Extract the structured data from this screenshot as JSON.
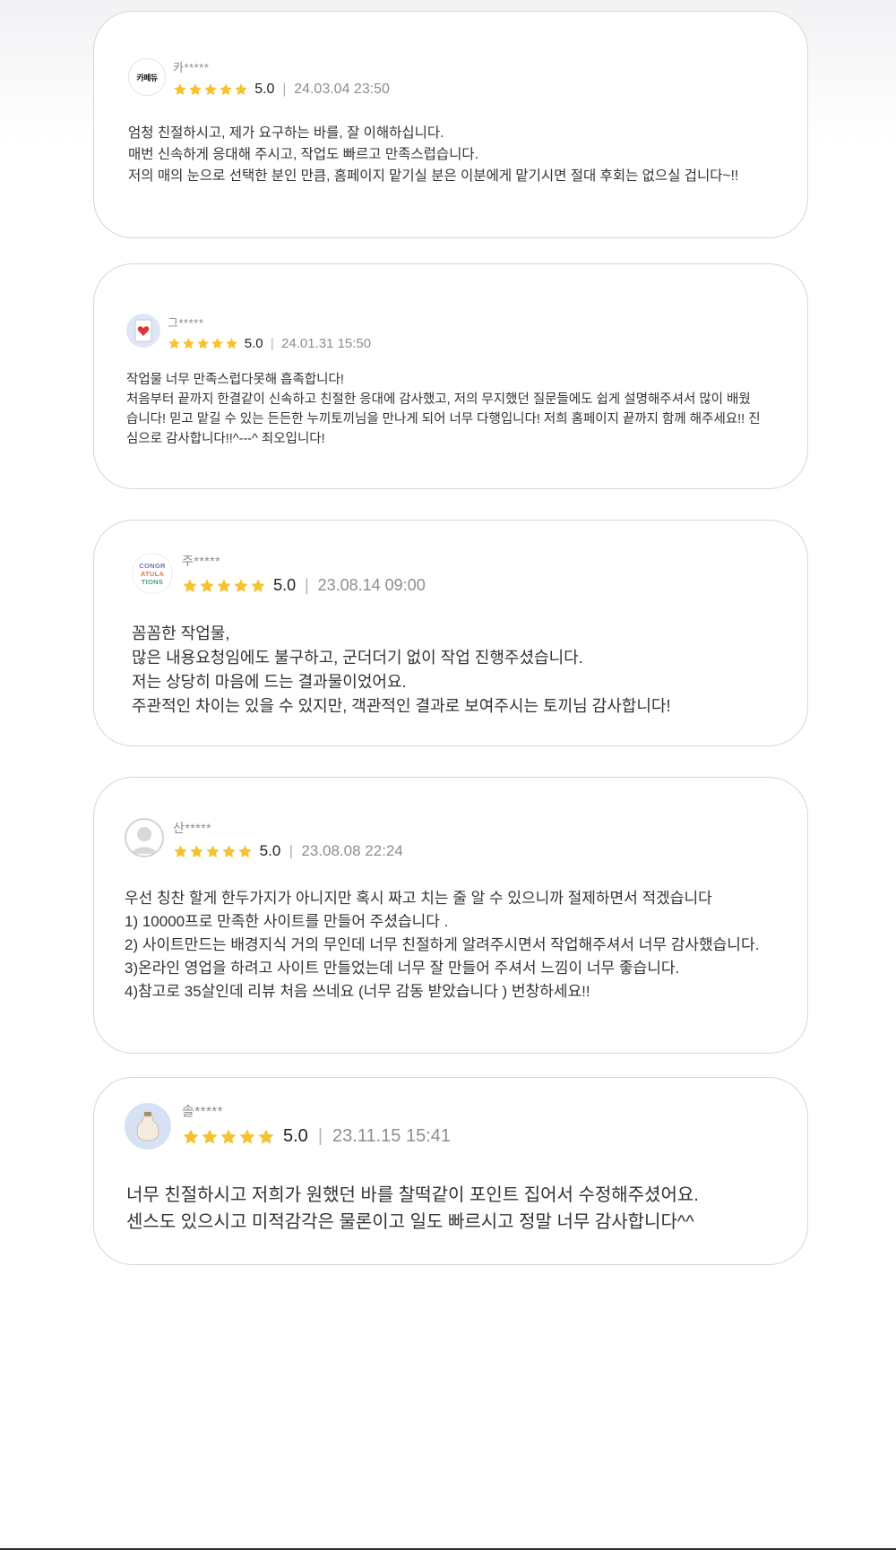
{
  "colors": {
    "star": "#f5c330",
    "border": "#d6d6d6",
    "muted": "#8d8d8d"
  },
  "reviews": [
    {
      "avatar_text": "카페듀",
      "avatar_icon": "cafe-logo-icon",
      "name": "카*****",
      "rating": "5.0",
      "stars": 5,
      "separator": "|",
      "date": "24.03.04 23:50",
      "lines": [
        "엄청 친절하시고, 제가 요구하는 바를, 잘 이해하십니다.",
        "매번 신속하게 응대해 주시고, 작업도 빠르고 만족스럽습니다.",
        "저의 매의 눈으로 선택한 분인 만큼, 홈페이지 맡기실 분은 이분에게 맡기시면 절대 후회는 없으실 겁니다~!!"
      ]
    },
    {
      "avatar_icon": "heart-card-icon",
      "name": "그*****",
      "rating": "5.0",
      "stars": 5,
      "separator": "|",
      "date": "24.01.31 15:50",
      "lines": [
        "작업물 너무 만족스럽다못해 흡족합니다!",
        "처음부터 끝까지 한결같이 신속하고 친절한 응대에 감사했고, 저의 무지했던 질문들에도 쉽게 설명해주셔서 많이 배웠",
        "습니다! 믿고 맡길 수 있는 든든한 누끼토끼님을 만나게 되어 너무 다행입니다! 저희 홈페이지 끝까지 함께 해주세요!! 진",
        "심으로 감사합니다!!^---^ 죄오입니다!"
      ]
    },
    {
      "avatar_text_lines": [
        "CONGR",
        "ATULA",
        "TIONS"
      ],
      "avatar_icon": "congratulations-icon",
      "name": "주*****",
      "rating": "5.0",
      "stars": 5,
      "separator": "|",
      "date": "23.08.14 09:00",
      "lines": [
        "꼼꼼한 작업물,",
        "많은 내용요청임에도 불구하고, 군더더기 없이 작업 진행주셨습니다.",
        "저는 상당히 마음에 드는 결과물이었어요.",
        "주관적인 차이는 있을 수 있지만, 객관적인 결과로 보여주시는 토끼님 감사합니다!"
      ]
    },
    {
      "avatar_icon": "default-user-icon",
      "name": "산*****",
      "rating": "5.0",
      "stars": 5,
      "separator": "|",
      "date": "23.08.08 22:24",
      "lines": [
        "우선 칭찬 할게 한두가지가 아니지만 혹시 짜고 치는 줄 알 수 있으니까  절제하면서 적겠습니다",
        "1) 10000프로  만족한 사이트를 만들어 주셨습니다 .",
        "2) 사이트만드는 배경지식 거의 무인데 너무 친절하게 알려주시면서 작업해주셔서 너무 감사했습니다.",
        "3)온라인 영업을 하려고 사이트 만들었는데 너무 잘 만들어 주셔서 느낌이 너무 좋습니다.",
        "4)참고로 35살인데 리뷰 처음 쓰네요 (너무 감동 받았습니다 ) 번창하세요!!"
      ]
    },
    {
      "avatar_icon": "jar-icon",
      "name": "솔*****",
      "rating": "5.0",
      "stars": 5,
      "separator": "|",
      "date": "23.11.15 15:41",
      "lines": [
        "너무 친절하시고 저희가 원했던 바를 찰떡같이 포인트 집어서 수정해주셨어요.",
        "센스도 있으시고 미적감각은 물론이고 일도 빠르시고 정말 너무 감사합니다^^"
      ]
    }
  ]
}
